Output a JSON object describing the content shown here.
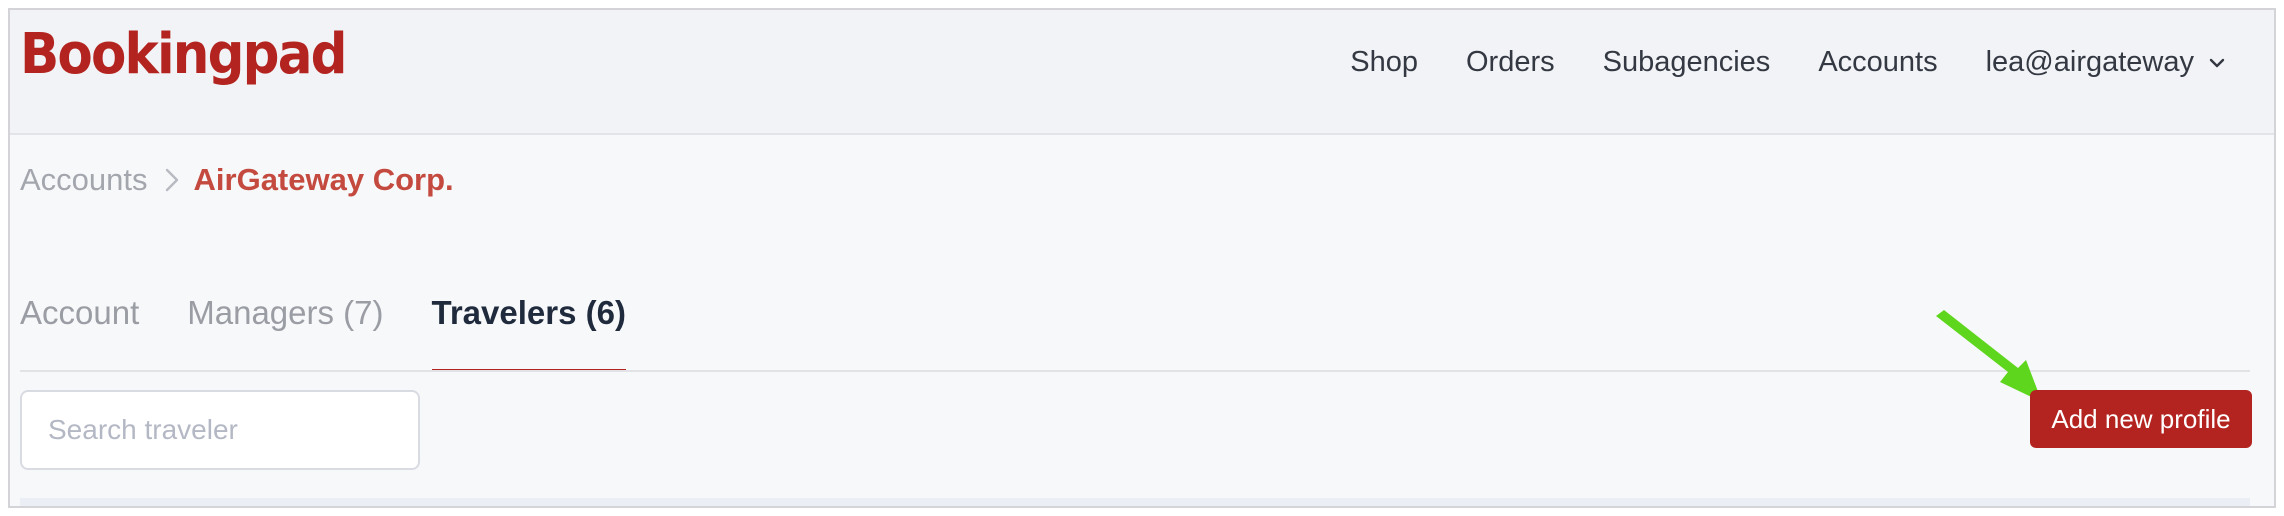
{
  "app": {
    "logo": "Bookingpad"
  },
  "nav": {
    "items": [
      "Shop",
      "Orders",
      "Subagencies",
      "Accounts"
    ],
    "user": "lea@airgateway"
  },
  "breadcrumb": {
    "parent": "Accounts",
    "current": "AirGateway Corp."
  },
  "tabs": [
    {
      "label": "Account",
      "active": false
    },
    {
      "label": "Managers (7)",
      "active": false
    },
    {
      "label": "Travelers (6)",
      "active": true
    }
  ],
  "search": {
    "placeholder": "Search traveler",
    "value": ""
  },
  "actions": {
    "add_profile_label": "Add new profile"
  },
  "colors": {
    "brand": "#b3231f",
    "breadcrumb_current": "#c44a3f",
    "annotation_arrow": "#5fd61e"
  },
  "icons": {
    "user_menu": "chevron-down-icon",
    "breadcrumb_separator": "chevron-right-icon",
    "annotation": "arrow-annotation"
  }
}
